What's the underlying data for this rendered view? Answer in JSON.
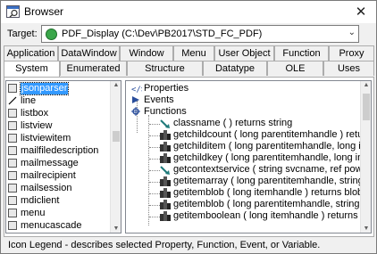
{
  "window": {
    "title": "Browser",
    "close_glyph": "✕"
  },
  "target": {
    "label": "Target:",
    "value": "PDF_Display (C:\\Dev\\PB2017\\STD_FC_PDF)",
    "arrow_glyph": "⌄"
  },
  "tabs_back": [
    "Application",
    "DataWindow",
    "Window",
    "Menu",
    "User Object",
    "Function",
    "Proxy"
  ],
  "tabs_front": [
    "System",
    "Enumerated",
    "Structure",
    "Datatype",
    "OLE",
    "Uses"
  ],
  "active_tab": "System",
  "objects_list": [
    "jsonparser",
    "line",
    "listbox",
    "listview",
    "listviewitem",
    "mailfiledescription",
    "mailmessage",
    "mailrecipient",
    "mailsession",
    "mdiclient",
    "menu",
    "menucascade"
  ],
  "selected_object": "jsonparser",
  "tree": {
    "categories": [
      "Properties",
      "Events",
      "Functions"
    ],
    "functions": [
      "classname ( ) returns string",
      "getchildcount ( long parentitemhandle ) returns long",
      "getchilditem ( long parentitemhandle, long index ) retu",
      "getchildkey ( long parentitemhandle, long index ) retu",
      "getcontextservice ( string svcname, ref powerobject s",
      "getitemarray ( long parentitemhandle, string key ) retu",
      "getitemblob ( long itemhandle ) returns blob",
      "getitemblob ( long parentitemhandle, string key ) retu",
      "getitemboolean ( long itemhandle ) returns boolean"
    ]
  },
  "legend": "Icon Legend - describes selected Property, Function, Event, or Variable.",
  "icons": {
    "app": "browser-icon",
    "properties": "properties-icon",
    "events": "events-icon",
    "functions": "functions-icon",
    "function_item": "function-icon",
    "inherited_function_item": "inherited-function-icon"
  },
  "colors": {
    "selection": "#3399ff",
    "window_bg": "#f0f0f0"
  }
}
